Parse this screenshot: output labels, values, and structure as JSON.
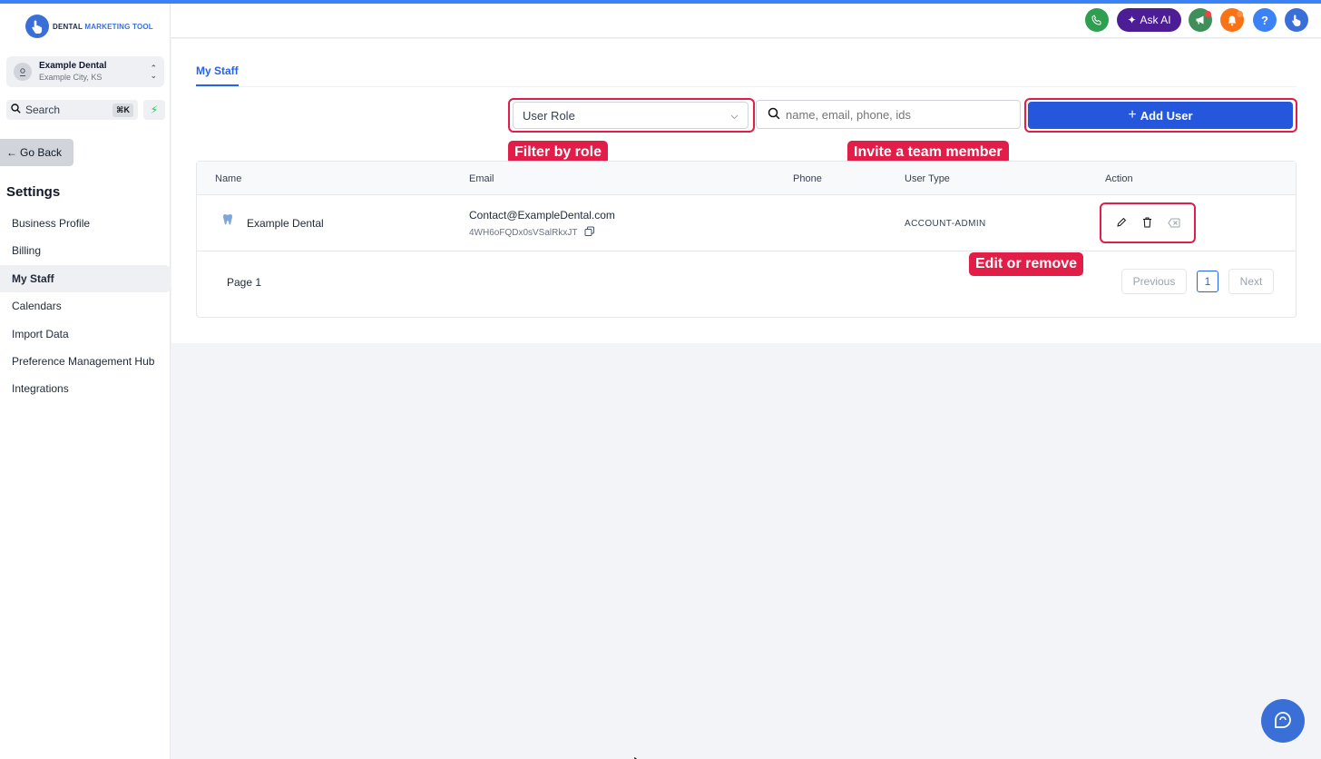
{
  "brand": {
    "logo_part1": "DENTAL",
    "logo_part2": "MARKETING TOOL"
  },
  "account": {
    "name": "Example Dental",
    "location": "Example City, KS"
  },
  "sidebar": {
    "search_label": "Search",
    "search_shortcut": "⌘K",
    "go_back": "Go Back",
    "settings_title": "Settings",
    "items": [
      {
        "label": "Business Profile"
      },
      {
        "label": "Billing"
      },
      {
        "label": "My Staff"
      },
      {
        "label": "Calendars"
      },
      {
        "label": "Import Data"
      },
      {
        "label": "Preference Management Hub"
      },
      {
        "label": "Integrations"
      }
    ]
  },
  "header": {
    "ask_ai": "Ask AI",
    "help": "?"
  },
  "page": {
    "tab": "My Staff",
    "role_placeholder": "User Role",
    "search_placeholder": "name, email, phone, ids",
    "add_user": "Add User"
  },
  "callouts": {
    "filter": "Filter by role",
    "invite": "Invite a team member",
    "edit": "Edit or remove"
  },
  "table": {
    "columns": [
      "Name",
      "Email",
      "Phone",
      "User Type",
      "Action"
    ],
    "rows": [
      {
        "name": "Example Dental",
        "email": "Contact@ExampleDental.com",
        "id": "4WH6oFQDx0sVSalRkxJT",
        "phone": "",
        "user_type": "ACCOUNT-ADMIN"
      }
    ]
  },
  "pagination": {
    "page_label": "Page 1",
    "previous": "Previous",
    "current": "1",
    "next": "Next"
  },
  "colors": {
    "accent": "#2457db",
    "annotation": "#e11d48",
    "askai": "#4c1d95",
    "phone": "#2e9e4f"
  }
}
